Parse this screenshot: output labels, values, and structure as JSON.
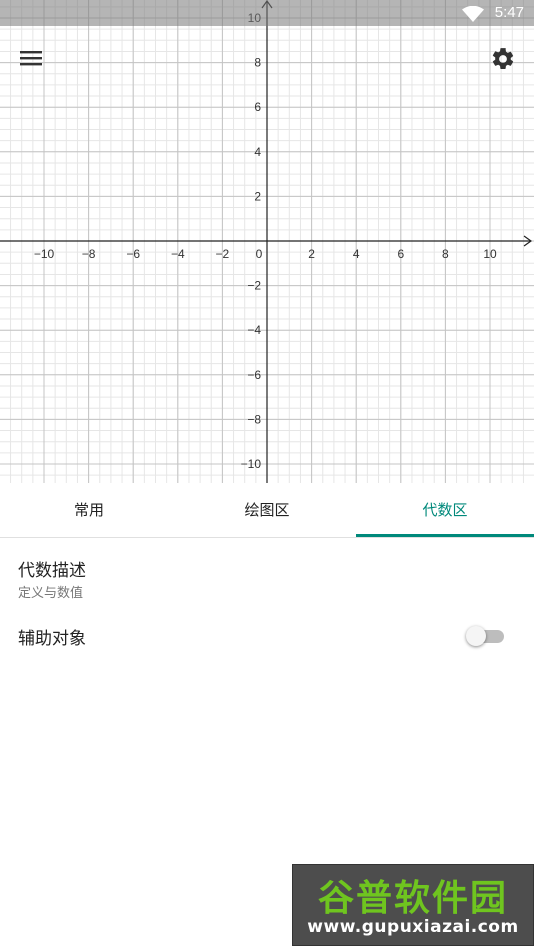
{
  "status_bar": {
    "time": "5:47",
    "wifi_icon": "wifi-icon"
  },
  "toolbar": {
    "menu_icon": "menu-icon",
    "settings_icon": "gear-icon"
  },
  "graph": {
    "x_ticks": [
      "−10",
      "−8",
      "−6",
      "−4",
      "−2",
      "0",
      "2",
      "4",
      "6",
      "8",
      "10"
    ],
    "y_ticks": [
      "10",
      "8",
      "6",
      "4",
      "2",
      "−2",
      "−4",
      "−6",
      "−8",
      "−10"
    ],
    "x_range": [
      -12,
      12
    ],
    "y_range": [
      -11,
      11
    ]
  },
  "tabs": [
    {
      "label": "常用",
      "active": false
    },
    {
      "label": "绘图区",
      "active": false
    },
    {
      "label": "代数区",
      "active": true
    }
  ],
  "panel": {
    "algebra_desc_title": "代数描述",
    "algebra_desc_sub": "定义与数值",
    "aux_objects_label": "辅助对象",
    "aux_objects_enabled": false
  },
  "watermark": {
    "brand": "谷普软件园",
    "url": "www.gupuxiazai.com"
  },
  "colors": {
    "accent": "#00897b"
  }
}
